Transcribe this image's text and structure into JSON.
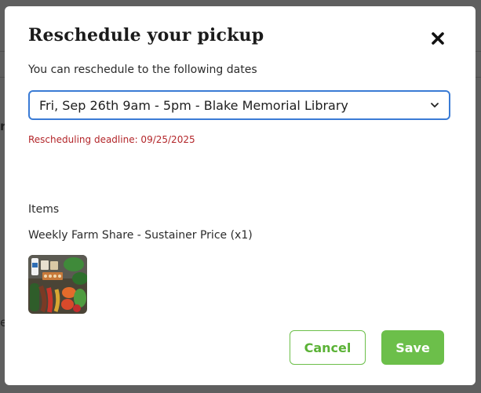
{
  "modal": {
    "title": "Reschedule your pickup",
    "subtitle": "You can reschedule to the following dates",
    "selected_date": "Fri, Sep 26th 9am - 5pm - Blake Memorial Library",
    "deadline": "Rescheduling deadline: 09/25/2025",
    "items_label": "Items",
    "item_name": "Weekly Farm Share - Sustainer Price (x1)",
    "cancel_label": "Cancel",
    "save_label": "Save"
  },
  "background": {
    "glyph_top": "r",
    "glyph_bottom": "e"
  },
  "colors": {
    "accent_green": "#6cbf4a",
    "deadline_red": "#b3262a",
    "select_border": "#3a7bd5"
  }
}
